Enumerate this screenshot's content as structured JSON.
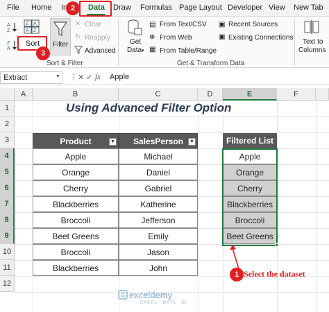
{
  "menu": {
    "file": "File",
    "home": "Home",
    "insert": "In",
    "data": "Data",
    "draw": "Draw",
    "formulas": "Formulas",
    "page_layout": "Page Layout",
    "developer": "Developer",
    "view": "View",
    "new_tab": "New Tab"
  },
  "ribbon": {
    "sort": "Sort",
    "filter": "Filter",
    "clear": "Clear",
    "reapply": "Reapply",
    "advanced": "Advanced",
    "sort_filter_group": "Sort & Filter",
    "get_data": "Get",
    "get_data2": "Data",
    "from_text_csv": "From Text/CSV",
    "from_web": "From Web",
    "from_table_range": "From Table/Range",
    "recent_sources": "Recent Sources",
    "existing_connections": "Existing Connections",
    "get_transform_group": "Get & Transform Data",
    "text_to": "Text to",
    "columns": "Columns"
  },
  "callouts": {
    "one": "1",
    "two": "2",
    "three": "3"
  },
  "formula_bar": {
    "name_box": "Extract",
    "fx": "fx",
    "value": "Apple"
  },
  "columns": [
    "A",
    "B",
    "C",
    "D",
    "E",
    "F"
  ],
  "rows": [
    "1",
    "2",
    "3",
    "4",
    "5",
    "6",
    "7",
    "8",
    "9",
    "10",
    "11",
    "12"
  ],
  "title": "Using Advanced Filter Option",
  "table": {
    "headers": [
      "Product",
      "SalesPerson"
    ],
    "rows": [
      [
        "Apple",
        "Michael"
      ],
      [
        "Orange",
        "Daniel"
      ],
      [
        "Cherry",
        "Gabriel"
      ],
      [
        "Blackberries",
        "Katherine"
      ],
      [
        "Broccoli",
        "Jefferson"
      ],
      [
        "Beet Greens",
        "Emily"
      ],
      [
        "Broccoli",
        "Jason"
      ],
      [
        "Blackberries",
        "John"
      ]
    ]
  },
  "filtered": {
    "header": "Filtered List",
    "items": [
      "Apple",
      "Orange",
      "Cherry",
      "Blackberries",
      "Broccoli",
      "Beet Greens"
    ]
  },
  "annotation": "Select the dataset",
  "watermark": {
    "name": "exceldemy",
    "tagline": "EXCEL · DATA · BI"
  },
  "colors": {
    "accent_red": "#e02020",
    "excel_green": "#1e7b3f",
    "header_gray": "#595959"
  }
}
